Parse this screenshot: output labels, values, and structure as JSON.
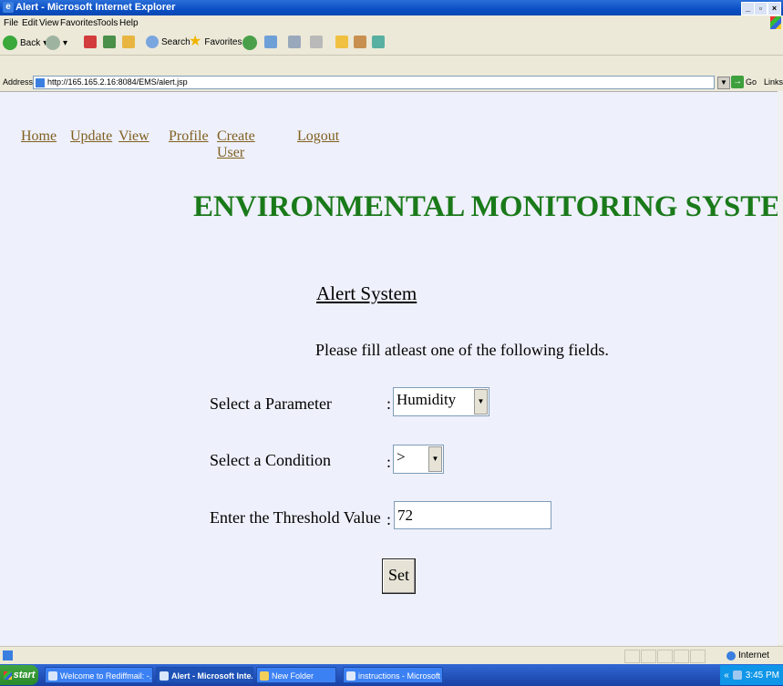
{
  "window": {
    "title": "Alert - Microsoft Internet Explorer",
    "btn_min": "_",
    "btn_max": "▫",
    "btn_close": "×"
  },
  "menu": [
    "File",
    "Edit",
    "View",
    "Favorites",
    "Tools",
    "Help"
  ],
  "toolbar": {
    "back": "Back",
    "search": "Search",
    "favorites": "Favorites"
  },
  "address": {
    "label": "Address",
    "url": "http://165.165.2.16:8084/EMS/alert.jsp",
    "go": "Go",
    "links": "Links"
  },
  "nav": {
    "home": "Home",
    "update": "Update",
    "view": "View",
    "profile": "Profile",
    "create_user_1": "Create",
    "create_user_2": "User",
    "logout": "Logout"
  },
  "heading": "ENVIRONMENTAL MONITORING SYSTEM",
  "alert": {
    "title": "Alert System",
    "instructions": "Please fill atleast one of the following fields.",
    "parameter_label": "Select a Parameter",
    "parameter_value": "Humidity",
    "condition_label": "Select a Condition",
    "condition_value": ">",
    "threshold_label": "Enter the Threshold Value",
    "threshold_value": "72",
    "colon": ":",
    "set_button": "Set"
  },
  "status": {
    "zone": "Internet"
  },
  "taskbar": {
    "start": "start",
    "tasks": [
      "Welcome to Rediffmail: -...",
      "Alert - Microsoft Inte...",
      "New Folder",
      "instructions - Microsoft ..."
    ],
    "clock": "3:45 PM",
    "tray_arrows": "«"
  },
  "colors": {
    "heading": "#1a7a1a",
    "nav_link": "#806020",
    "content_bg": "#eef0fb"
  }
}
